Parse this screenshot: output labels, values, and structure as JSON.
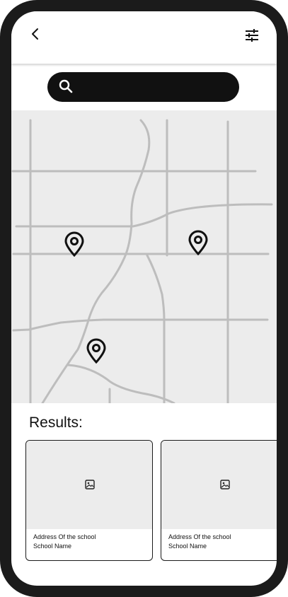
{
  "header": {
    "back_icon": "chevron-left-icon",
    "filter_icon": "sliders-icon"
  },
  "search": {
    "placeholder": "",
    "value": "",
    "icon": "search-icon"
  },
  "map": {
    "pins": [
      "map-pin-1",
      "map-pin-2",
      "map-pin-3"
    ],
    "background": "#ececec",
    "road_color": "#bdbdbd"
  },
  "results": {
    "title": "Results:",
    "cards": [
      {
        "address": "Address Of the school",
        "name": "School Name"
      },
      {
        "address": "Address Of the school",
        "name": "School Name"
      }
    ]
  },
  "colors": {
    "frame": "#1b1b1b",
    "search_bg": "#111111",
    "image_placeholder": "#ececec"
  }
}
